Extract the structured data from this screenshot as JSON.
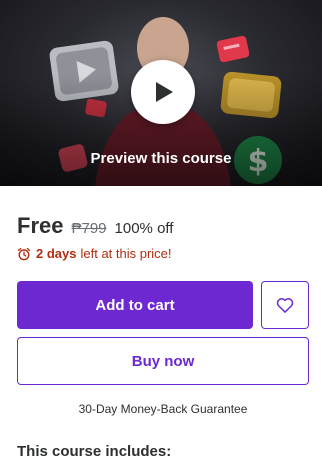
{
  "preview": {
    "label": "Preview this course",
    "play_icon": "play-icon"
  },
  "pricing": {
    "current": "Free",
    "original": "₱799",
    "discount": "100% off"
  },
  "timer": {
    "icon": "alarm-clock-icon",
    "days": "2 days",
    "suffix": "left at this price!"
  },
  "actions": {
    "add_to_cart": "Add to cart",
    "wishlist_icon": "heart-icon",
    "buy_now": "Buy now"
  },
  "guarantee": "30-Day Money-Back Guarantee",
  "includes_heading": "This course includes:",
  "colors": {
    "accent": "#6d28d2",
    "urgency": "#b32d0f",
    "text": "#2d2f31",
    "muted": "#6a6f73"
  }
}
